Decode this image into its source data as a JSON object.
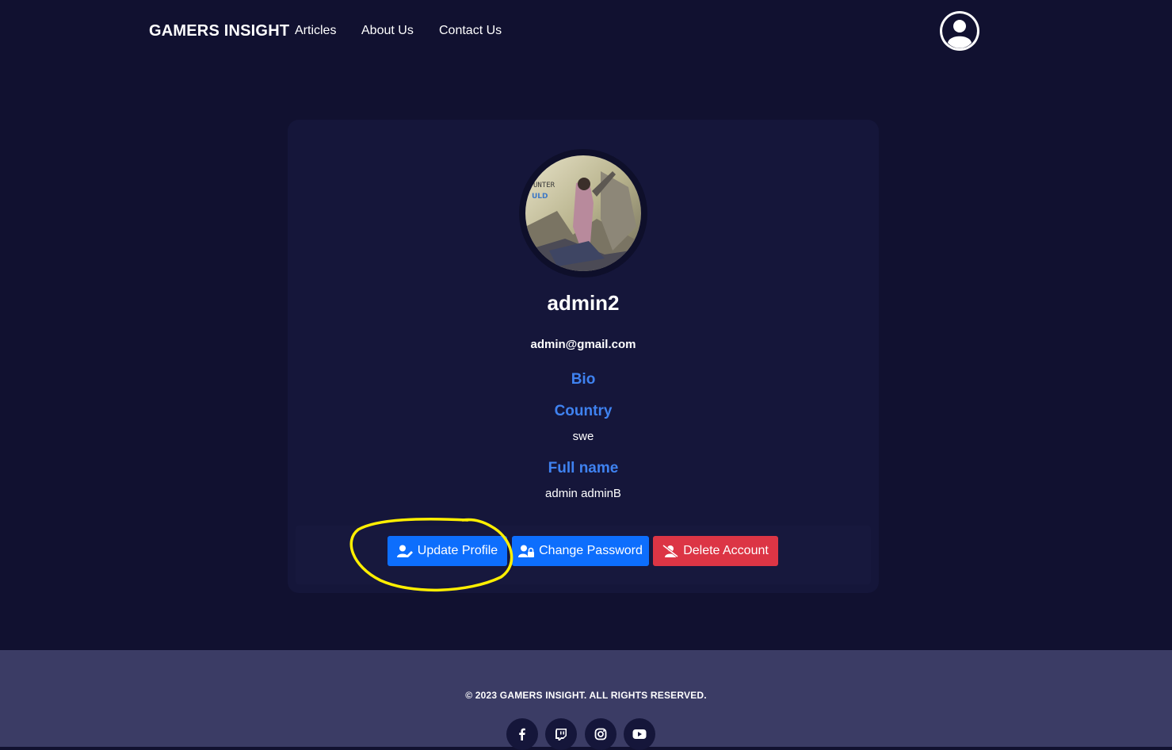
{
  "nav": {
    "brand": "GAMERS INSIGHT",
    "links": [
      {
        "label": "Articles"
      },
      {
        "label": "About Us"
      },
      {
        "label": "Contact Us"
      }
    ],
    "avatar_icon": "user-circle-icon"
  },
  "profile": {
    "username": "admin2",
    "email": "admin@gmail.com",
    "bio_label": "Bio",
    "bio_value": "",
    "country_label": "Country",
    "country_value": "swe",
    "fullname_label": "Full name",
    "fullname_value": "admin adminB"
  },
  "actions": {
    "update_label": "Update Profile",
    "password_label": "Change Password",
    "delete_label": "Delete Account"
  },
  "footer": {
    "copyright": "© 2023 GAMERS INSIGHT. ALL RIGHTS RESERVED.",
    "social_icons": [
      "facebook-icon",
      "twitch-icon",
      "instagram-icon",
      "youtube-icon"
    ]
  },
  "colors": {
    "background": "#111130",
    "card": "#15163a",
    "accent": "#3f82f0",
    "primary_button": "#0d6efd",
    "danger_button": "#dc3545",
    "footer": "#3b3c65",
    "highlight": "#ffef00"
  }
}
